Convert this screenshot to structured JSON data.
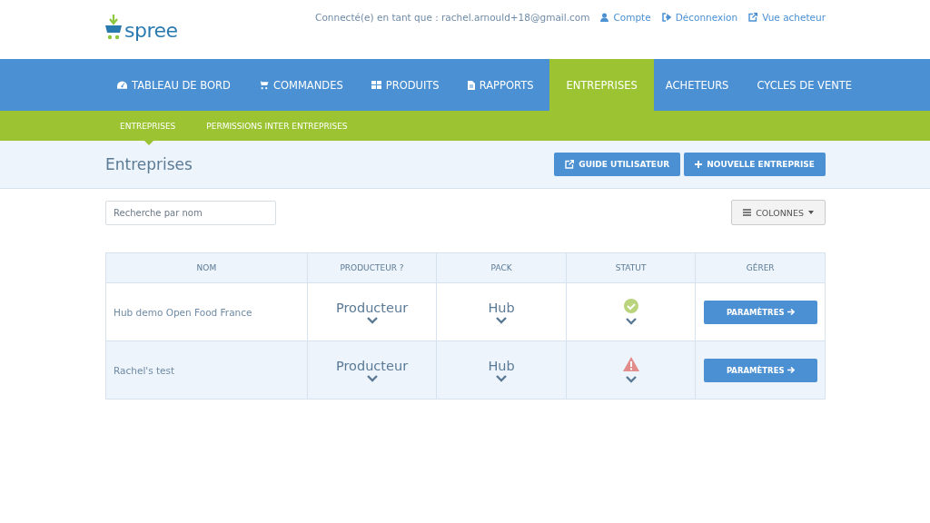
{
  "header": {
    "logo": "spree",
    "login_label": "Connecté(e) en tant que : rachel.arnould+18@gmail.com",
    "links": [
      {
        "label": "Compte"
      },
      {
        "label": "Déconnexion"
      },
      {
        "label": "Vue acheteur"
      }
    ]
  },
  "nav": [
    {
      "label": "TABLEAU DE BORD",
      "selected": false
    },
    {
      "label": "COMMANDES",
      "selected": false
    },
    {
      "label": "PRODUITS",
      "selected": false
    },
    {
      "label": "RAPPORTS",
      "selected": false
    },
    {
      "label": "ENTREPRISES",
      "selected": true
    },
    {
      "label": "ACHETEURS",
      "selected": false
    },
    {
      "label": "CYCLES DE VENTE",
      "selected": false
    }
  ],
  "subnav": [
    {
      "label": "ENTREPRISES",
      "selected": true
    },
    {
      "label": "PERMISSIONS INTER ENTREPRISES",
      "selected": false
    }
  ],
  "page_title": "Entreprises",
  "actions": [
    {
      "label": "GUIDE UTILISATEUR"
    },
    {
      "label": "NOUVELLE ENTREPRISE"
    }
  ],
  "search": {
    "placeholder": "Recherche par nom"
  },
  "columns_button": "COLONNES",
  "table": {
    "columns": [
      "NOM",
      "PRODUCTEUR ?",
      "PACK",
      "STATUT",
      "GÉRER"
    ],
    "rows": [
      {
        "name": "Hub demo Open Food France",
        "producer": "Producteur",
        "pack": "Hub",
        "valid": true,
        "action": "PARAMÈTRES"
      },
      {
        "name": "Rachel's test",
        "producer": "Producteur",
        "pack": "Hub",
        "valid": false,
        "action": "PARAMÈTRES"
      }
    ]
  }
}
